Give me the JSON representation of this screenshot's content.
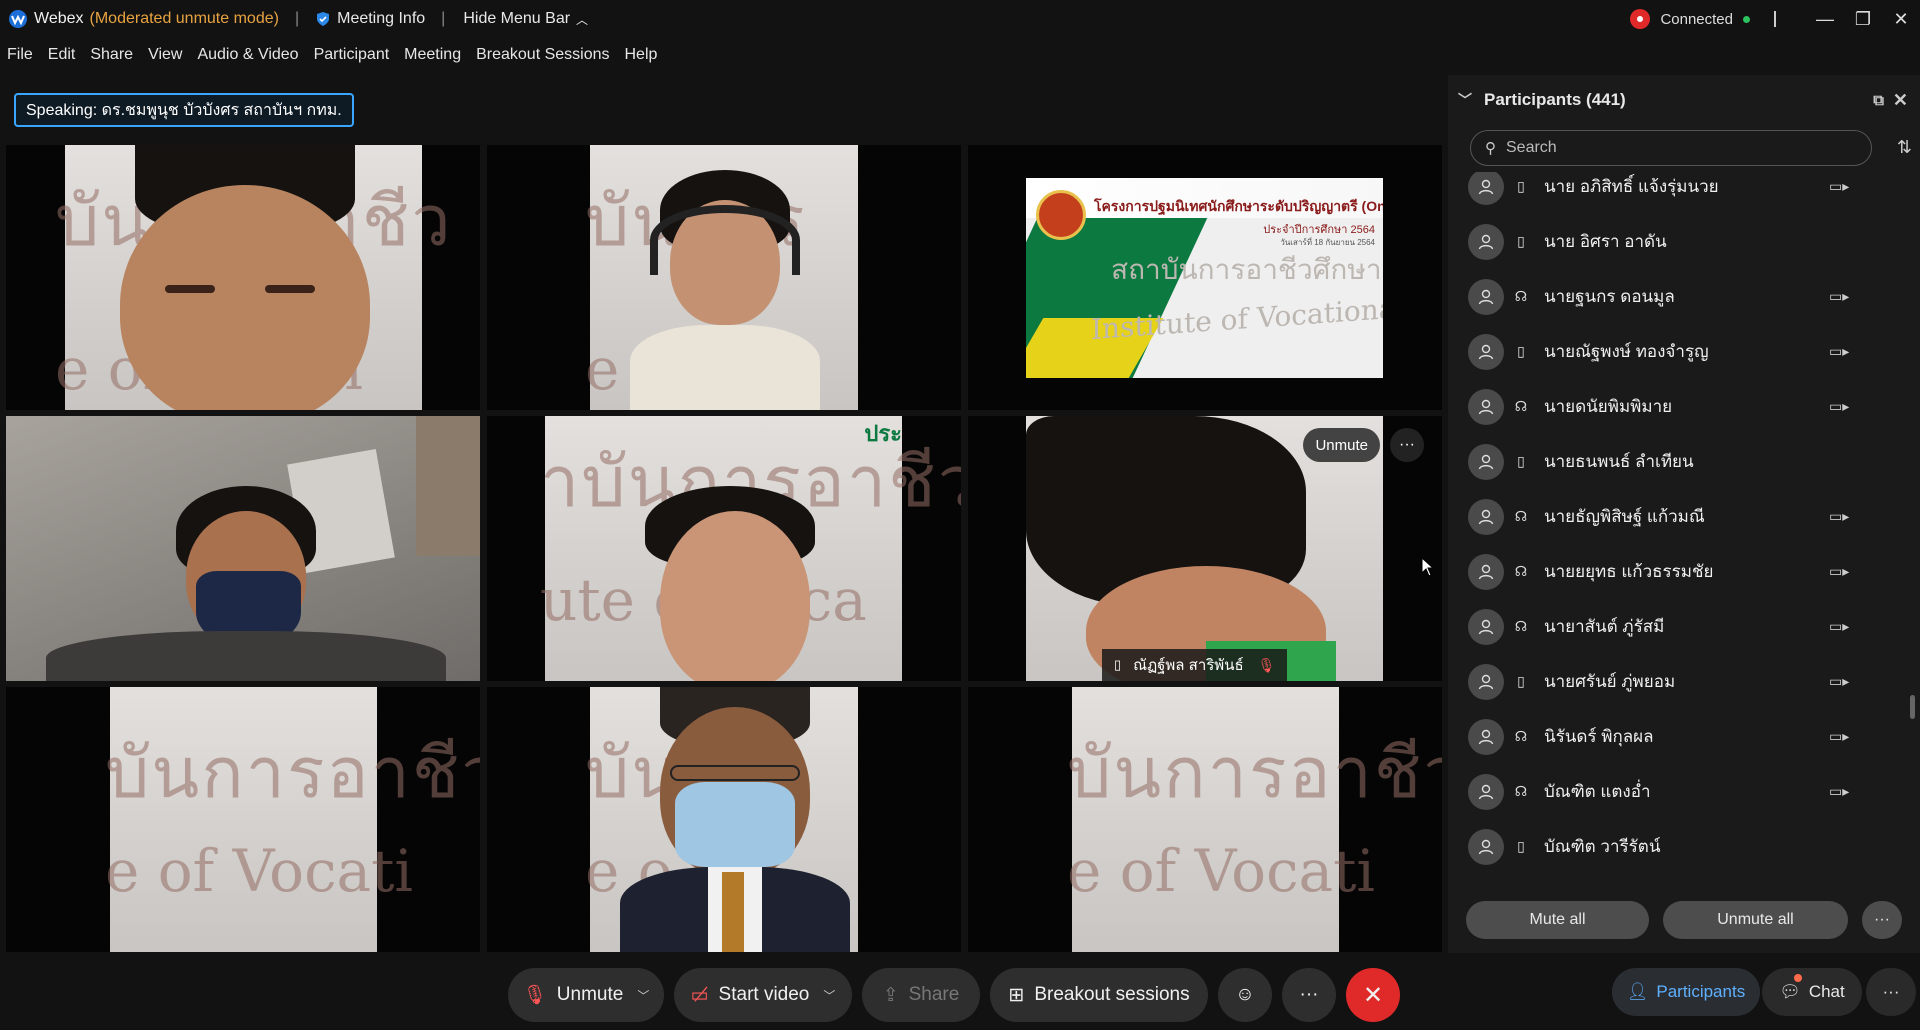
{
  "titlebar": {
    "app_name": "Webex",
    "mode": "(Moderated unmute mode)",
    "separator": "|",
    "meeting_info": "Meeting Info",
    "hide_menu": "Hide Menu Bar",
    "status": "Connected",
    "buttons": {
      "minimize": "—",
      "restore": "❐",
      "close": "✕"
    }
  },
  "menu": [
    "File",
    "Edit",
    "Share",
    "View",
    "Audio & Video",
    "Participant",
    "Meeting",
    "Breakout Sessions",
    "Help"
  ],
  "speaking": "Speaking: ดร.ชมพูนุช บัวบังศร สถาบันฯ กทม.",
  "banner": {
    "title": "โครงการปฐมนิเทศนักศึกษาระดับปริญญาตรี (Online)",
    "subtitle": "ประจำปีการศึกษา 2564",
    "date": "วันเสาร์ที่ 18 กันยายน 2564",
    "thai_wall": "สถาบันการอาชีวศึกษากรุงเทพมหานคร",
    "english_wall": "Institute of Vocational Education, Bangk"
  },
  "tile6": {
    "unmute_label": "Unmute",
    "more_label": "···",
    "name": "ณัฏฐ์พล สาริพันธ์"
  },
  "tile5_overlay": "ประ",
  "participants_panel": {
    "title": "Participants (441)",
    "search_placeholder": "Search",
    "participants": [
      {
        "name": "นาย อภิสิทธิ์ แจ้งรุ่มนวย",
        "device": "phone",
        "video": true
      },
      {
        "name": "นาย อิศรา อาดัน",
        "device": "phone",
        "video": false
      },
      {
        "name": "นายฐนกร ดอนมูล",
        "device": "headset",
        "video": true
      },
      {
        "name": "นายณัฐพงษ์ ทองจำรูญ",
        "device": "phone",
        "video": true
      },
      {
        "name": "นายดนัยพิมพิมาย",
        "device": "headset",
        "video": true
      },
      {
        "name": "นายธนพนธ์ ลำเทียน",
        "device": "phone",
        "video": false
      },
      {
        "name": "นายธัญพิสิษฐ์ แก้วมณี",
        "device": "headset",
        "video": true
      },
      {
        "name": "นายยยุทธ แก้วธรรมชัย",
        "device": "headset",
        "video": true
      },
      {
        "name": "นายาสันต์ ภู่รัสมี",
        "device": "headset",
        "video": true
      },
      {
        "name": "นายศรันย์ ภู่พยอม",
        "device": "phone",
        "video": true
      },
      {
        "name": "นิรันดร์ พิกุลผล",
        "device": "headset",
        "video": true
      },
      {
        "name": "บัณฑิต แตงอ่ำ",
        "device": "headset",
        "video": true
      },
      {
        "name": "บัณฑิต วารีรัตน์",
        "device": "phone",
        "video": false
      }
    ],
    "mute_all": "Mute all",
    "unmute_all": "Unmute all",
    "more": "···"
  },
  "controls": {
    "unmute": "Unmute",
    "start_video": "Start video",
    "share": "Share",
    "breakout": "Breakout sessions",
    "more": "···",
    "leave": "✕"
  },
  "tabs": {
    "participants": "Participants",
    "chat": "Chat",
    "more": "···"
  },
  "colors": {
    "accent": "#3aa6ff",
    "muted_red": "#ff5656",
    "leave_red": "#e02a2a",
    "connected_green": "#2cc35e",
    "mode_orange": "#e8a341"
  }
}
